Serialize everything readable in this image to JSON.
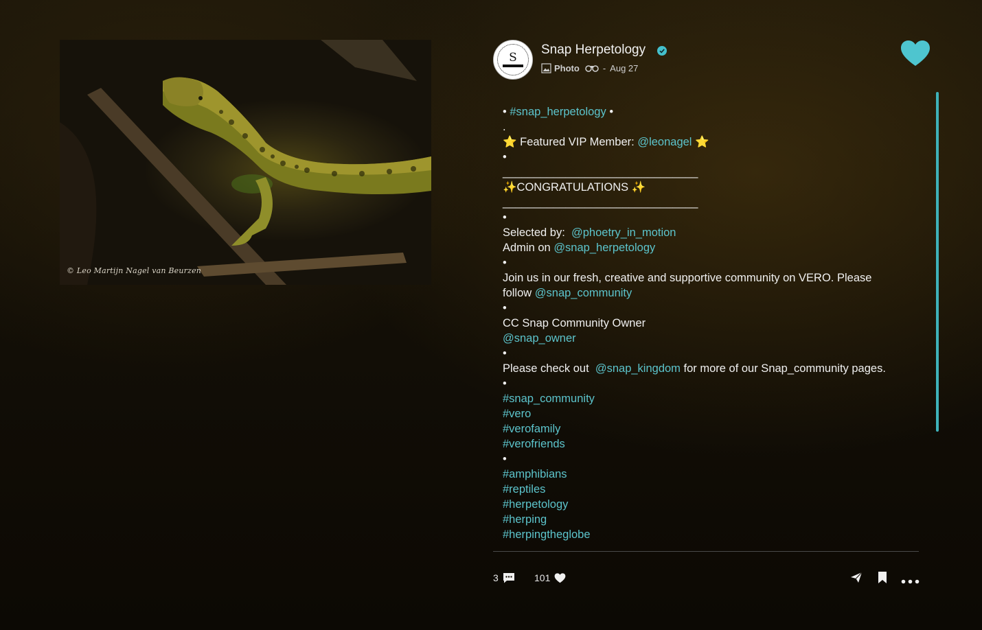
{
  "photo": {
    "credit": "© Leo Martijn Nagel van Beurzen",
    "subject_icon": "lizard-photo"
  },
  "post": {
    "avatar_text": "S",
    "account_name": "Snap Herpetology",
    "verified_icon": "verified-check-icon",
    "type_label": "Photo",
    "date": "Aug 27",
    "date_separator": "-"
  },
  "caption": {
    "line_hashtag_open": "•",
    "line_hashtag": "#snap_herpetology",
    "line_hashtag_close": "•",
    "dot1": ".",
    "featured_prefix": "⭐ Featured VIP Member:",
    "featured_user": "@leonagel",
    "featured_suffix": "⭐",
    "dot2": "•",
    "rule1": "_______________________________",
    "congrats": "✨CONGRATULATIONS ✨",
    "rule2": "_______________________________",
    "dot3": "•",
    "selected_by_label": "Selected by:",
    "selected_by_user": "@phoetry_in_motion",
    "admin_on_label": "Admin on",
    "admin_on_user": "@snap_herpetology",
    "dot4": "•",
    "join_text": "Join us in our fresh, creative and supportive community on VERO. Please follow",
    "join_user": "@snap_community",
    "dot5": "•",
    "owner_label": "CC Snap Community Owner",
    "owner_user": "@snap_owner",
    "dot6": "•",
    "check_prefix": "Please check out",
    "check_user": "@snap_kingdom",
    "check_suffix": "for more of our Snap_community pages.",
    "dot7": "•",
    "tags1": [
      "#snap_community",
      "#vero",
      "#verofamily",
      "#verofriends"
    ],
    "dot8": "•",
    "tags2": [
      "#amphibians",
      "#reptiles",
      "#herpetology",
      "#herping",
      "#herpingtheglobe"
    ]
  },
  "footer": {
    "comment_count": "3",
    "like_count": "101"
  },
  "colors": {
    "accent": "#4ec5cf",
    "link": "#5cc4cc",
    "background": "#161108"
  }
}
